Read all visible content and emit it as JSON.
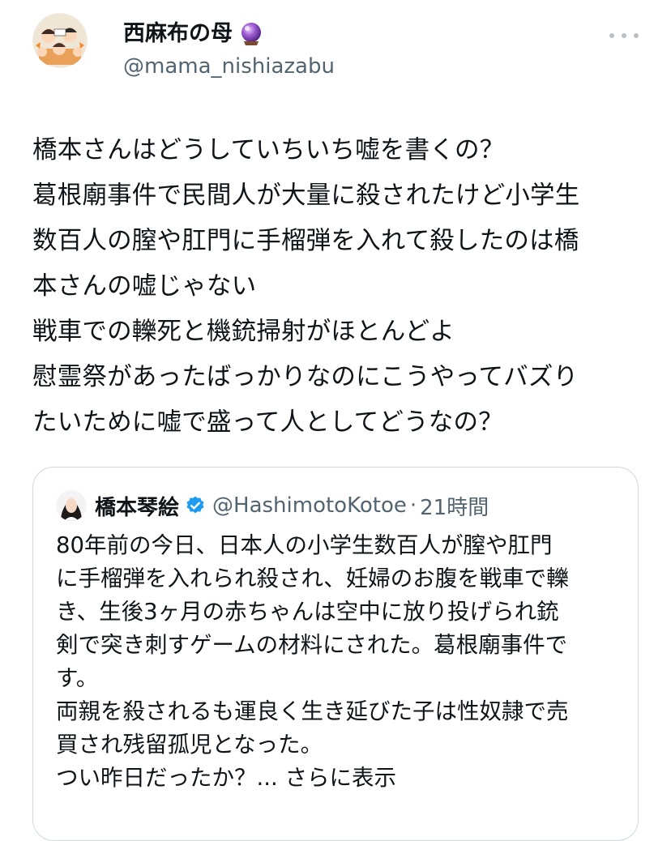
{
  "author": {
    "display_name": "西麻布の母",
    "handle": "@mama_nishiazabu"
  },
  "tweet": {
    "lines": [
      "橋本さんはどうしていちいち嘘を書くの？",
      "葛根廟事件で民間人が大量に殺されたけど小学生",
      "数百人の膣や肛門に手榴弾を入れて殺したのは橋",
      "本さんの嘘じゃない",
      "戦車での轢死と機銃掃射がほとんどよ",
      "慰霊祭があったばっかりなのにこうやってバズり",
      "たいために嘘で盛って人としてどうなの？"
    ]
  },
  "quoted": {
    "display_name": "橋本琴絵",
    "handle": "@HashimotoKotoe",
    "separator": "·",
    "time": "21時間",
    "lines": [
      "80年前の今日、日本人の小学生数百人が膣や肛門",
      "に手榴弾を入れられ殺され、妊婦のお腹を戦車で轢",
      "き、生後3ヶ月の赤ちゃんは空中に放り投げられ銃",
      "剣で突き刺すゲームの材料にされた。葛根廟事件で",
      "す。",
      "両親を殺されるも運良く生き延びた子は性奴隷で売",
      "買され残留孤児となった。",
      "つい昨日だったか？... さらに表示"
    ]
  },
  "icons": {
    "crystal": "crystal-ball-icon",
    "verified": "verified-badge-icon",
    "more": "more-options-icon"
  },
  "colors": {
    "text": "#0f1419",
    "secondary": "#536471",
    "verified": "#1d9bf0",
    "border": "#cfd9de"
  }
}
